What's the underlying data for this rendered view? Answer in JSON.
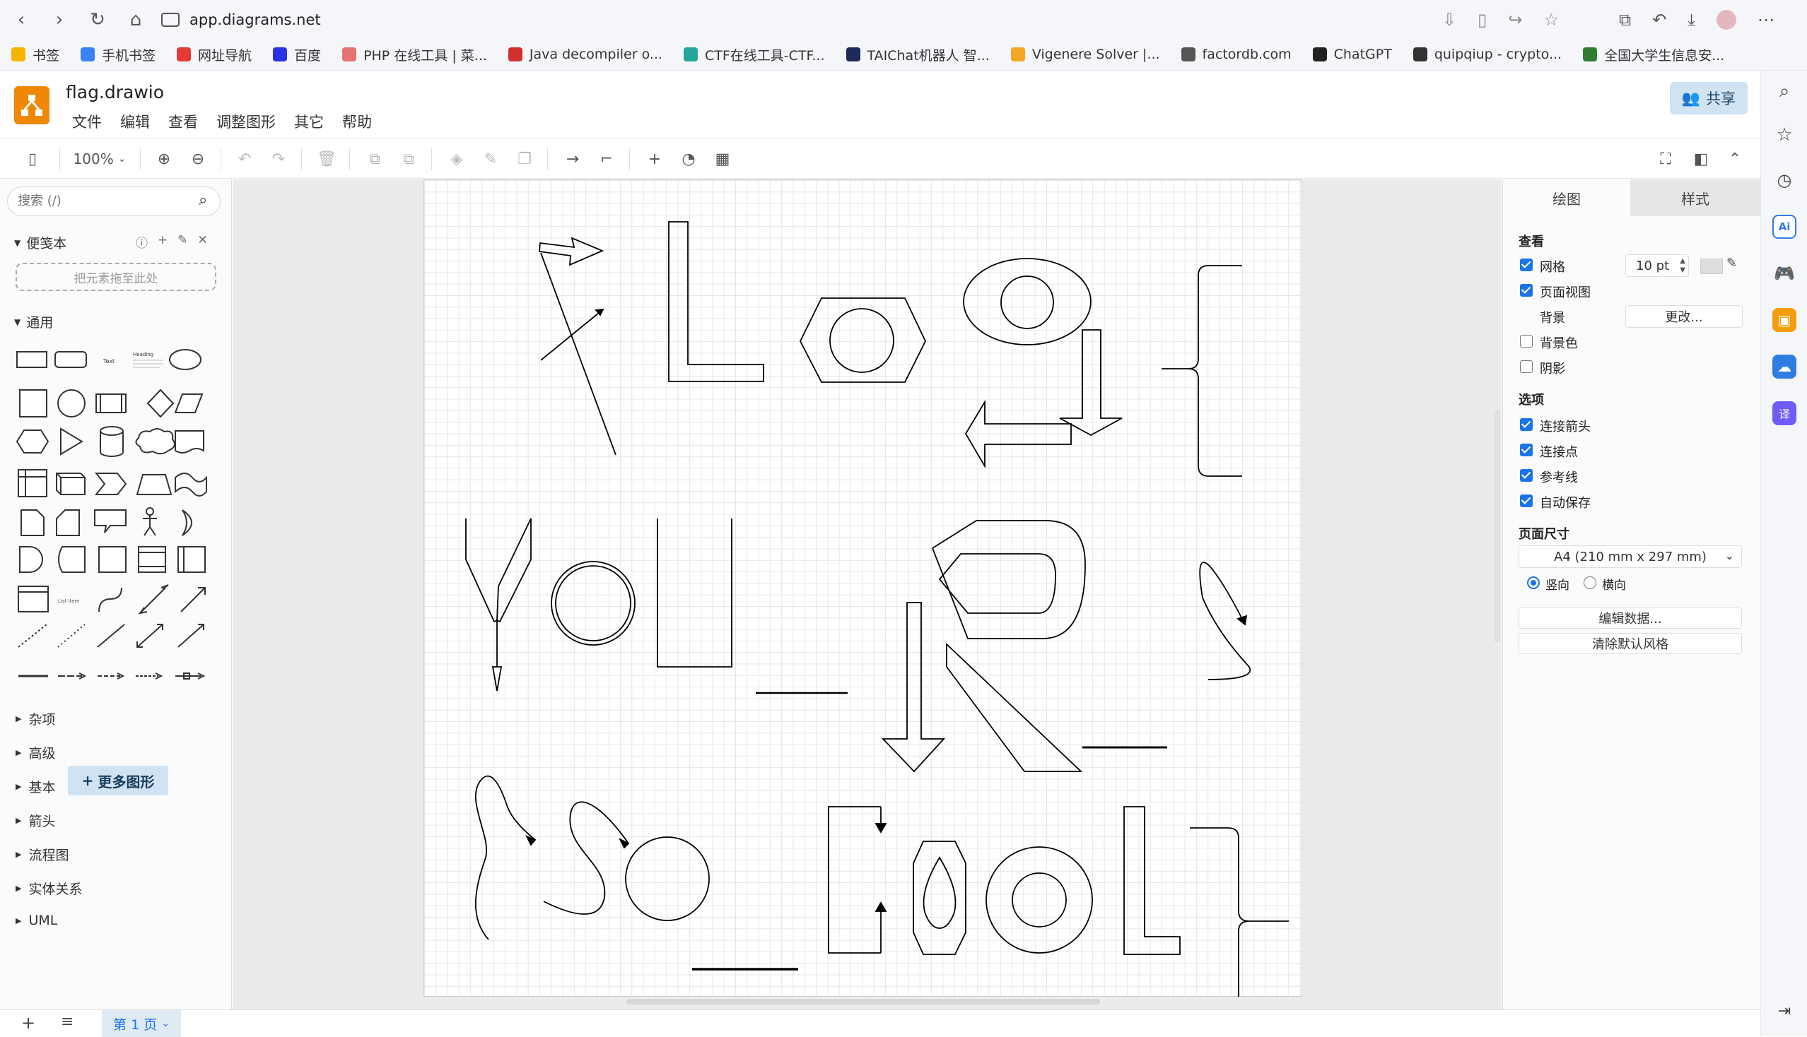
{
  "browser": {
    "url": "app.diagrams.net",
    "bookmarks": [
      {
        "label": "书签",
        "color": "#f6b400"
      },
      {
        "label": "手机书签",
        "color": "#3b82f6"
      },
      {
        "label": "网址导航",
        "color": "#e53935"
      },
      {
        "label": "百度",
        "color": "#2932e1"
      },
      {
        "label": "PHP 在线工具 | 菜...",
        "color": "#e57373"
      },
      {
        "label": "Java decompiler o...",
        "color": "#d32f2f"
      },
      {
        "label": "CTF在线工具-CTF...",
        "color": "#26a69a"
      },
      {
        "label": "TAIChat机器人 智...",
        "color": "#1e2a5a"
      },
      {
        "label": "Vigenere Solver |...",
        "color": "#f5a623"
      },
      {
        "label": "factordb.com",
        "color": "#555555"
      },
      {
        "label": "ChatGPT",
        "color": "#222222"
      },
      {
        "label": "quipqiup - crypto...",
        "color": "#333333"
      },
      {
        "label": "全国大学生信息安...",
        "color": "#2e7d32"
      }
    ]
  },
  "app": {
    "doc_title": "flag.drawio",
    "menu": [
      "文件",
      "编辑",
      "查看",
      "调整图形",
      "其它",
      "帮助"
    ],
    "share_label": "共享"
  },
  "toolbar": {
    "zoom": "100%"
  },
  "sidebar": {
    "search_placeholder": "搜索 (/)",
    "scratchpad_title": "便笺本",
    "drop_hint": "把元素拖至此处",
    "general_title": "通用",
    "categories": [
      "杂项",
      "高级",
      "基本",
      "箭头",
      "流程图",
      "实体关系",
      "UML"
    ],
    "more_shapes": "更多图形"
  },
  "format_panel": {
    "tabs": [
      "绘图",
      "样式"
    ],
    "view_title": "查看",
    "grid_label": "网格",
    "grid_size": "10 pt",
    "page_view_label": "页面视图",
    "background_label": "背景",
    "change_button": "更改...",
    "bg_color_label": "背景色",
    "shadow_label": "阴影",
    "options_title": "选项",
    "connection_arrows": "连接箭头",
    "connection_points": "连接点",
    "guides": "参考线",
    "autosave": "自动保存",
    "page_size_title": "页面尺寸",
    "page_size": "A4 (210 mm x 297 mm)",
    "portrait": "竖向",
    "landscape": "横向",
    "edit_data": "编辑数据...",
    "clear_style": "清除默认风格"
  },
  "bottom": {
    "page_tab": "第 1 页"
  }
}
